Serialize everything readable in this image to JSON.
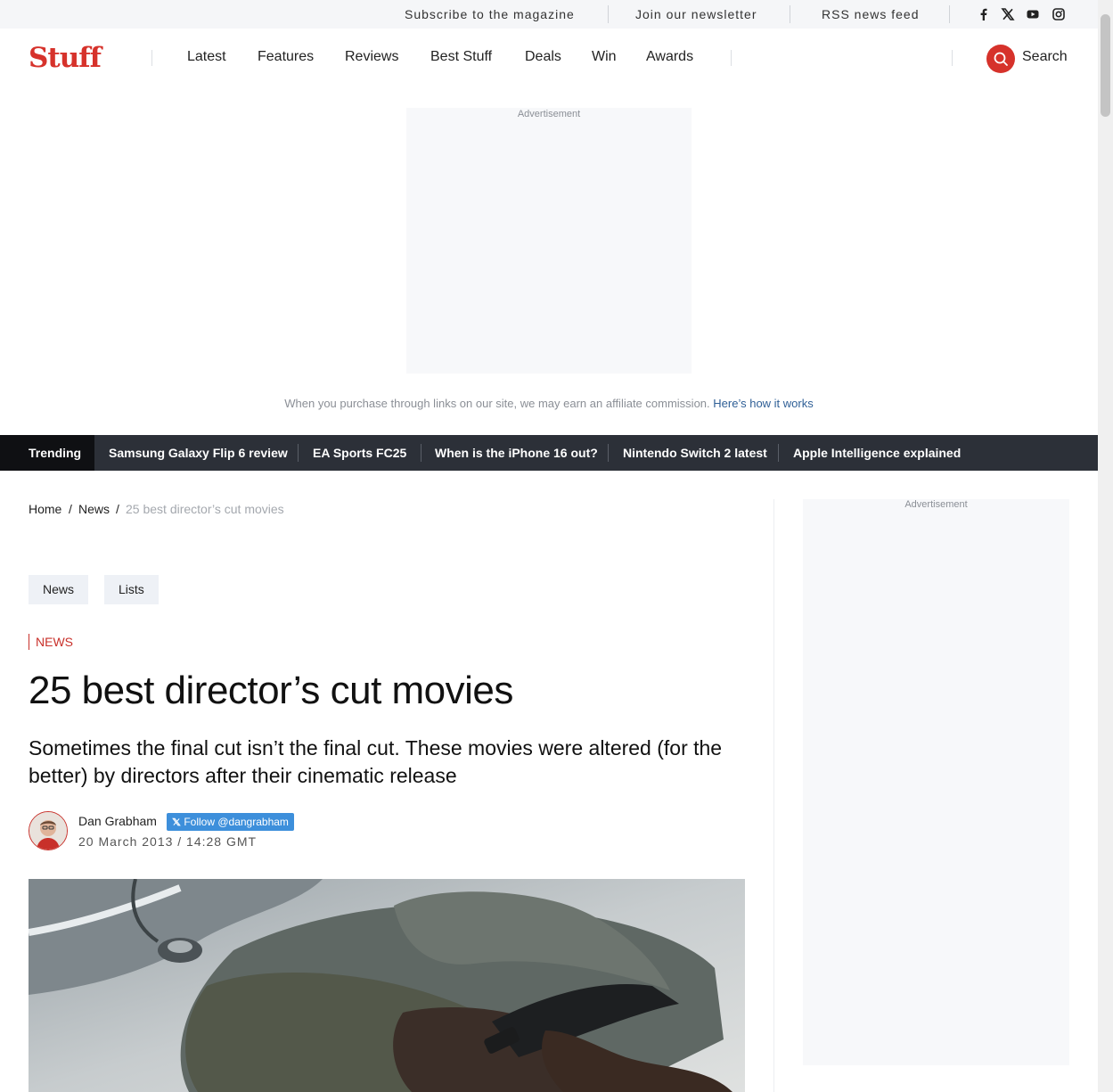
{
  "utility": {
    "subscribe": "Subscribe to the magazine",
    "newsletter": "Join our newsletter",
    "rss": "RSS news feed",
    "social": [
      "facebook-icon",
      "x-icon",
      "youtube-icon",
      "instagram-icon"
    ]
  },
  "brand": {
    "logo": "Stuff",
    "color": "#d6322b"
  },
  "nav": {
    "items": [
      "Latest",
      "Features",
      "Reviews",
      "Best Stuff",
      "Deals",
      "Win",
      "Awards"
    ],
    "search_label": "Search"
  },
  "ads": {
    "label": "Advertisement"
  },
  "affiliate": {
    "text": "When you purchase through links on our site, we may earn an affiliate commission.",
    "link": "Here’s how it works"
  },
  "trending": {
    "label": "Trending",
    "items": [
      "Samsung Galaxy Flip 6 review",
      "EA Sports FC25",
      "When is the iPhone 16 out?",
      "Nintendo Switch 2 latest",
      "Apple Intelligence explained"
    ]
  },
  "breadcrumb": {
    "home": "Home",
    "sep": "/",
    "section": "News",
    "current": "25 best director’s cut movies"
  },
  "tags": [
    "News",
    "Lists"
  ],
  "article": {
    "kicker": "NEWS",
    "headline": "25 best director’s cut movies",
    "standfirst": "Sometimes the final cut isn’t the final cut. These movies were altered (for the better) by directors after their cinematic release",
    "author": "Dan Grabham",
    "follow": "Follow @dangrabham",
    "date": "20 March 2013 / 14:28 GMT"
  }
}
